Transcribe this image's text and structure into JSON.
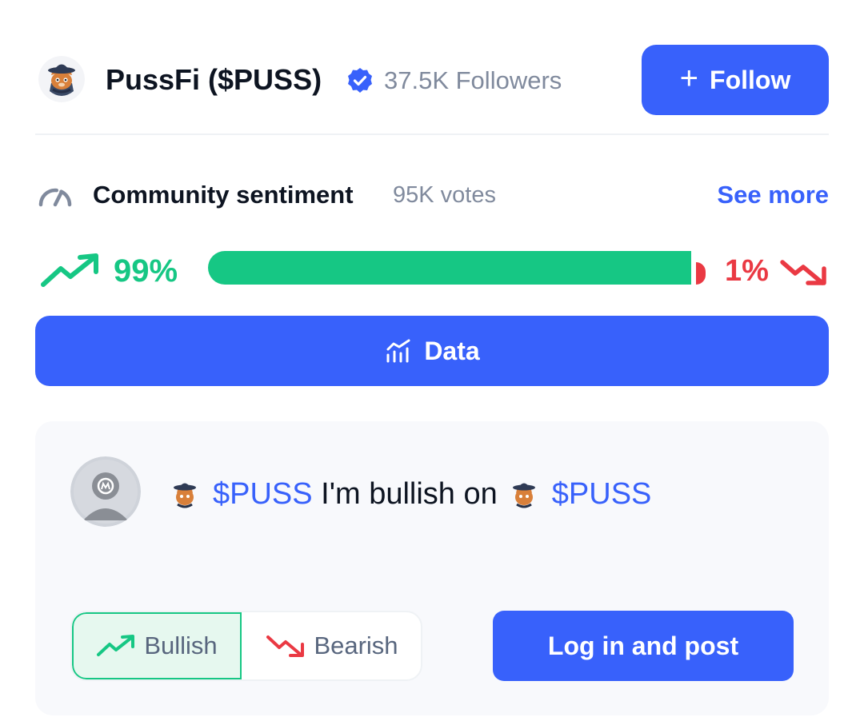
{
  "header": {
    "title": "PussFi ($PUSS)",
    "followers": "37.5K Followers",
    "follow_label": "Follow",
    "avatar_icon": "cat-cowboy-avatar"
  },
  "sentiment": {
    "title": "Community sentiment",
    "votes": "95K votes",
    "see_more": "See more",
    "bullish_pct_label": "99%",
    "bearish_pct_label": "1%",
    "bullish_fraction": 0.99,
    "bearish_fraction": 0.01
  },
  "data_button": {
    "label": "Data"
  },
  "post": {
    "ticker_1": "$PUSS",
    "text": " I'm bullish on",
    "ticker_2": "$PUSS",
    "bullish_label": "Bullish",
    "bearish_label": "Bearish",
    "login_label": "Log in and post"
  },
  "colors": {
    "brand": "#3861fb",
    "bullish": "#16c784",
    "bearish": "#ea3943",
    "muted": "#808a9d"
  }
}
